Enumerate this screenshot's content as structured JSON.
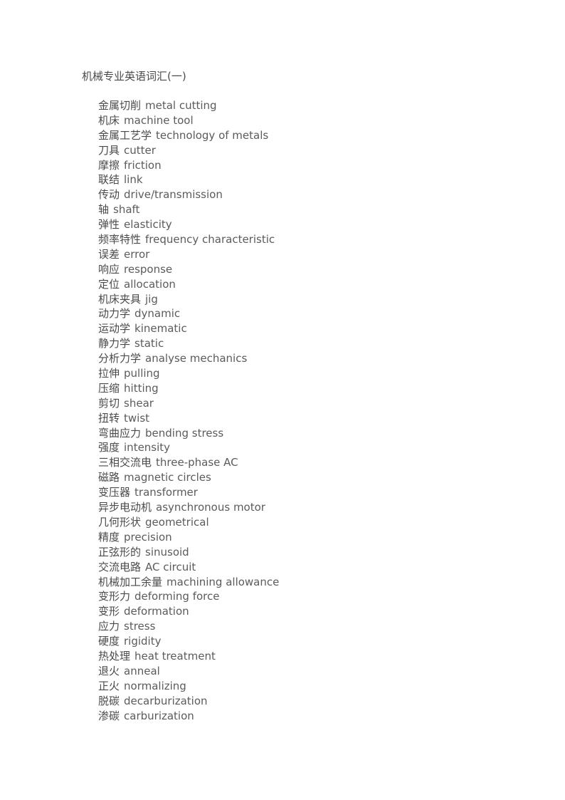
{
  "document": {
    "title": "机械专业英语词汇(一)",
    "background_color": "#ffffff",
    "text_color": "#4a4a4a",
    "english_text_color": "#5b5b5b"
  },
  "vocabulary": [
    {
      "cn": "金属切削",
      "en": "metal cutting"
    },
    {
      "cn": "机床",
      "en": "machine tool"
    },
    {
      "cn": "金属工艺学",
      "en": "technology of metals"
    },
    {
      "cn": "刀具",
      "en": "cutter"
    },
    {
      "cn": "摩擦",
      "en": "friction"
    },
    {
      "cn": "联结",
      "en": "link"
    },
    {
      "cn": "传动",
      "en": "drive/transmission"
    },
    {
      "cn": "轴",
      "en": "shaft"
    },
    {
      "cn": "弹性",
      "en": "elasticity"
    },
    {
      "cn": "频率特性",
      "en": "frequency characteristic"
    },
    {
      "cn": "误差",
      "en": "error"
    },
    {
      "cn": "响应",
      "en": "response"
    },
    {
      "cn": "定位",
      "en": "allocation"
    },
    {
      "cn": "机床夹具",
      "en": "jig"
    },
    {
      "cn": "动力学",
      "en": "dynamic"
    },
    {
      "cn": "运动学",
      "en": "kinematic"
    },
    {
      "cn": "静力学",
      "en": "static"
    },
    {
      "cn": "分析力学",
      "en": "analyse mechanics"
    },
    {
      "cn": "拉伸",
      "en": "pulling"
    },
    {
      "cn": "压缩",
      "en": "hitting"
    },
    {
      "cn": "剪切",
      "en": "shear"
    },
    {
      "cn": "扭转",
      "en": "twist"
    },
    {
      "cn": "弯曲应力",
      "en": "bending stress"
    },
    {
      "cn": "强度",
      "en": "intensity"
    },
    {
      "cn": "三相交流电",
      "en": "three-phase AC"
    },
    {
      "cn": "磁路",
      "en": "magnetic circles"
    },
    {
      "cn": "变压器",
      "en": "transformer"
    },
    {
      "cn": "异步电动机",
      "en": "asynchronous motor"
    },
    {
      "cn": "几何形状",
      "en": "geometrical"
    },
    {
      "cn": "精度",
      "en": "precision"
    },
    {
      "cn": "正弦形的",
      "en": "sinusoid"
    },
    {
      "cn": "交流电路",
      "en": "AC circuit"
    },
    {
      "cn": "机械加工余量",
      "en": "machining allowance"
    },
    {
      "cn": "变形力",
      "en": "deforming force"
    },
    {
      "cn": "变形",
      "en": "deformation"
    },
    {
      "cn": "应力",
      "en": "stress"
    },
    {
      "cn": "硬度",
      "en": "rigidity"
    },
    {
      "cn": "热处理",
      "en": "heat treatment"
    },
    {
      "cn": "退火",
      "en": "anneal"
    },
    {
      "cn": "正火",
      "en": "normalizing"
    },
    {
      "cn": "脱碳",
      "en": "decarburization"
    },
    {
      "cn": "渗碳",
      "en": "carburization"
    }
  ]
}
